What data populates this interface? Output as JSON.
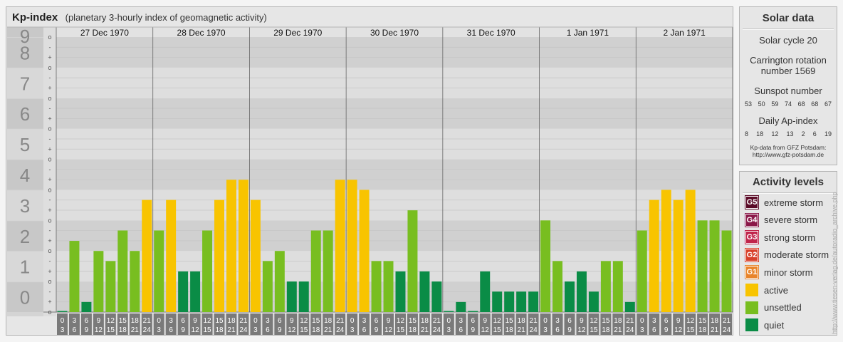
{
  "header": {
    "title": "Kp-index",
    "subtitle": "(planetary 3-hourly index of geomagnetic activity)"
  },
  "chart_data": {
    "type": "bar",
    "y_ticks": [
      "0",
      "1",
      "2",
      "3",
      "4",
      "5",
      "6",
      "7",
      "8",
      "9"
    ],
    "y_subticks": [
      "-",
      "o",
      "+"
    ],
    "ylim": [
      0,
      9
    ],
    "days": [
      "27 Dec 1970",
      "28 Dec 1970",
      "29 Dec 1970",
      "30 Dec 1970",
      "31 Dec 1970",
      "1 Jan 1971",
      "2 Jan 1971"
    ],
    "intervals": [
      [
        "0",
        "3"
      ],
      [
        "3",
        "6"
      ],
      [
        "6",
        "9"
      ],
      [
        "9",
        "12"
      ],
      [
        "12",
        "15"
      ],
      [
        "15",
        "18"
      ],
      [
        "18",
        "21"
      ],
      [
        "21",
        "24"
      ]
    ],
    "values": [
      [
        0.0,
        2.33,
        0.33,
        2.0,
        1.67,
        2.67,
        2.0,
        3.67
      ],
      [
        2.67,
        3.67,
        1.33,
        1.33,
        2.67,
        3.67,
        4.33,
        4.33
      ],
      [
        3.67,
        1.67,
        2.0,
        1.0,
        1.0,
        2.67,
        2.67,
        4.33
      ],
      [
        4.33,
        4.0,
        1.67,
        1.67,
        1.33,
        3.33,
        1.33,
        1.0
      ],
      [
        0.0,
        0.33,
        0.0,
        1.33,
        0.67,
        0.67,
        0.67,
        0.67
      ],
      [
        3.0,
        1.67,
        1.0,
        1.33,
        0.67,
        1.67,
        1.67,
        0.33
      ],
      [
        2.67,
        3.67,
        4.0,
        3.67,
        4.0,
        3.0,
        3.0,
        2.67
      ]
    ],
    "colors": {
      "quiet": "#0a8c46",
      "unsettled": "#78be20",
      "active": "#f8c400"
    }
  },
  "solar": {
    "title": "Solar data",
    "cycle": "Solar cycle 20",
    "carrington_line1": "Carrington rotation",
    "carrington_line2": "number 1569",
    "sunspot_title": "Sunspot number",
    "sunspot_values": [
      "53",
      "50",
      "59",
      "74",
      "68",
      "68",
      "67"
    ],
    "ap_title": "Daily Ap-index",
    "ap_values": [
      "8",
      "18",
      "12",
      "13",
      "2",
      "6",
      "19"
    ],
    "credit_line1": "Kp-data from GFZ Potsdam:",
    "credit_line2": "http://www.gfz-potsdam.de"
  },
  "levels": {
    "title": "Activity levels",
    "items": [
      {
        "badge": "G5",
        "label": "extreme storm",
        "color": "#5a0a26"
      },
      {
        "badge": "G4",
        "label": "severe storm",
        "color": "#8a1848"
      },
      {
        "badge": "G3",
        "label": "strong storm",
        "color": "#c0244a"
      },
      {
        "badge": "G2",
        "label": "moderate storm",
        "color": "#d8402a"
      },
      {
        "badge": "G1",
        "label": "minor storm",
        "color": "#e8842a"
      },
      {
        "badge": "",
        "label": "active",
        "color": "#f8c400"
      },
      {
        "badge": "",
        "label": "unsettled",
        "color": "#78be20"
      },
      {
        "badge": "",
        "label": "quiet",
        "color": "#0a8c46"
      }
    ]
  },
  "watermark": "http://www.tiesen-verlag.de/autoradio_archive.php"
}
